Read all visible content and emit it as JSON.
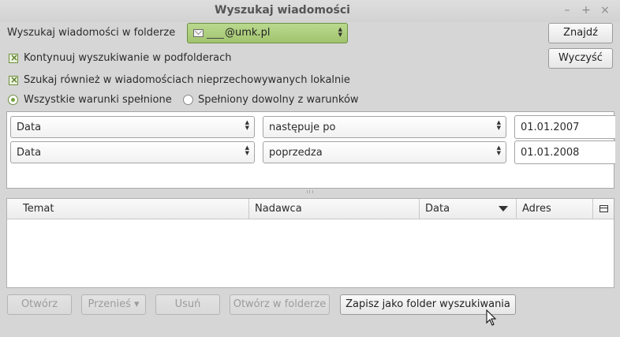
{
  "window": {
    "title": "Wyszukaj wiadomości",
    "controls": {
      "minimize": "–",
      "maximize": "+",
      "close": "×"
    }
  },
  "search": {
    "folder_label": "Wyszukaj wiadomości w folderze",
    "folder_value": "@umk.pl",
    "find_button": "Znajdź",
    "clear_button": "Wyczyść",
    "subfolders_checkbox": "Kontynuuj wyszukiwanie w podfolderach",
    "nonlocal_checkbox": "Szukaj również w wiadomościach nieprzechowywanych lokalnie",
    "radio_all": "Wszystkie warunki spełnione",
    "radio_any": "Spełniony dowolny z warunków"
  },
  "criteria": [
    {
      "field": "Data",
      "operator": "następuje po",
      "value": "01.01.2007"
    },
    {
      "field": "Data",
      "operator": "poprzedza",
      "value": "01.01.2008"
    }
  ],
  "results": {
    "columns": [
      "Temat",
      "Nadawca",
      "Data",
      "Adres"
    ]
  },
  "actions": {
    "open": "Otwórz",
    "move": "Przenieś ▾",
    "delete": "Usuń",
    "open_in_folder": "Otwórz w folderze",
    "save_as_search_folder": "Zapisz jako folder wyszukiwania"
  },
  "colors": {
    "accent_green": "#a2c46f",
    "window_bg": "#d6d6d6"
  }
}
